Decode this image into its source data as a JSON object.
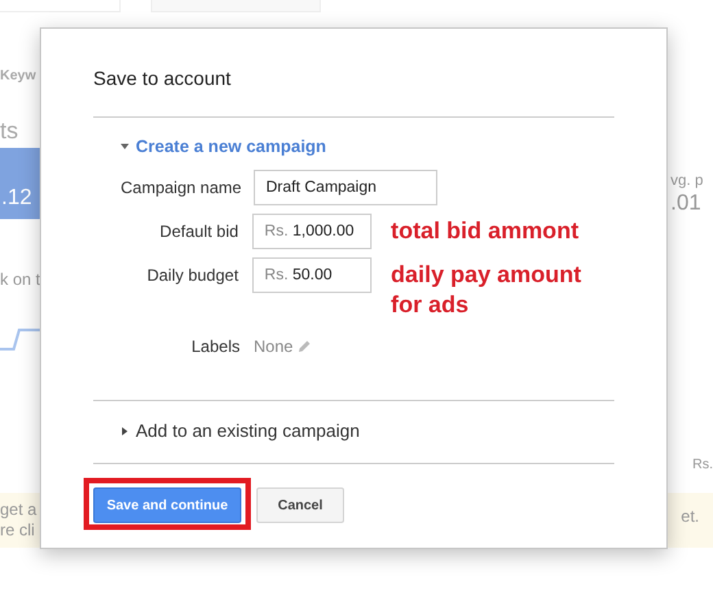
{
  "background": {
    "left_texts": [
      "Keyw",
      "ts",
      ".12",
      "k on t"
    ],
    "right_texts": [
      "vg. p",
      ".01",
      "Rs."
    ],
    "notice_left": [
      "get a",
      "re cli"
    ],
    "notice_right": "et."
  },
  "dialog": {
    "title": "Save to account",
    "sections": [
      {
        "title": "Create a new campaign",
        "expanded": true,
        "fields": [
          {
            "kind": "text",
            "label": "Campaign name",
            "value": "Draft Campaign"
          },
          {
            "kind": "money",
            "label": "Default bid",
            "prefix": "Rs.",
            "value": "1,000.00",
            "note": "total bid ammont"
          },
          {
            "kind": "money",
            "label": "Daily budget",
            "prefix": "Rs.",
            "value": "50.00",
            "note": "daily pay amount for ads"
          },
          {
            "kind": "labels",
            "label": "Labels",
            "value": "None"
          }
        ]
      },
      {
        "title": "Add to an existing campaign",
        "expanded": false
      }
    ],
    "buttons": [
      {
        "kind": "primary",
        "label": "Save and continue",
        "highlighted": true
      },
      {
        "kind": "secondary",
        "label": "Cancel",
        "highlighted": false
      }
    ]
  }
}
